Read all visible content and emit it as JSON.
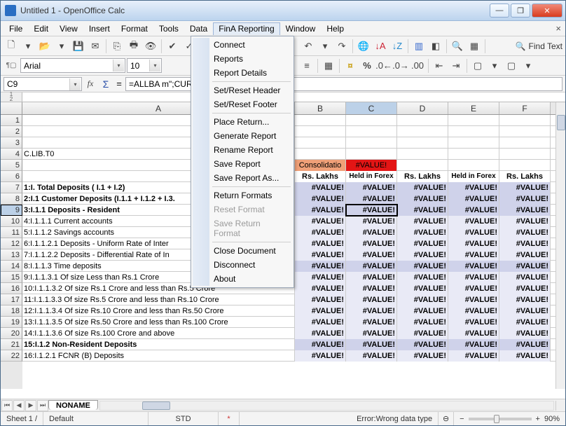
{
  "title": "Untitled 1 - OpenOffice Calc",
  "menus": [
    "File",
    "Edit",
    "View",
    "Insert",
    "Format",
    "Tools",
    "Data",
    "FinA Reporting",
    "Window",
    "Help"
  ],
  "open_menu_index": 7,
  "dropdown": {
    "groups": [
      [
        "Connect",
        "Reports",
        "Report Details"
      ],
      [
        "Set/Reset Header",
        "Set/Reset Footer"
      ],
      [
        "Place Return...",
        "Generate Report",
        "Rename Report",
        "Save Report",
        "Save Report As..."
      ],
      [
        "Return Formats",
        "Reset Format",
        "Save Return Format"
      ],
      [
        "Close Document",
        "Disconnect",
        "About"
      ]
    ],
    "disabled": [
      "Reset Format",
      "Save Return Format"
    ]
  },
  "find_label": "Find Text",
  "font": {
    "name": "Arial",
    "size": "10"
  },
  "namebox": "C9",
  "formula": "=ALLBA                                   m\";CURPERIOD();\"last\";0)",
  "columns": [
    "A",
    "B",
    "C",
    "D",
    "E",
    "F"
  ],
  "selected_col": "C",
  "col_widths": {
    "A": 389,
    "B": 73,
    "C": 73,
    "D": 73,
    "E": 73,
    "F": 73
  },
  "row_start": 1,
  "row_end": 22,
  "selected_row": 9,
  "a_values": {
    "4": "C.LIB.T0",
    "7": "1:I. Total Deposits ( I.1 + I.2)",
    "8": "2:I.1 Customer Deposits (I.1.1 + I.1.2 + I.3.",
    "9": "3:I.1.1 Deposits - Resident",
    "10": "4:I.1.1.1 Current accounts",
    "11": "5:I.1.1.2 Savings accounts",
    "12": "6:I.1.1.2.1 Deposits - Uniform Rate of Inter",
    "13": "7:I.1.1.2.2 Deposits - Differential Rate of In",
    "14": "8:I.1.1.3 Time deposits",
    "15": "9:I.1.1.3.1 Of size Less than Rs.1 Crore",
    "16": "10:I.1.1.3.2 Of size Rs.1 Crore and less than Rs.5 Crore",
    "17": "11:I.1.1.3.3 Of size Rs.5 Crore and less than Rs.10 Crore",
    "18": "12:I.1.1.3.4 Of size Rs.10 Crore and less than Rs.50 Crore",
    "19": "13:I.1.1.3.5 Of size Rs.50 Crore and less than Rs.100 Crore",
    "20": "14:I.1.1.3.6 Of size Rs.100 Crore and above",
    "21": "15:I.1.2 Non-Resident Deposits",
    "22": "16:I.1.2.1 FCNR (B) Deposits"
  },
  "header_row5": {
    "B": "Consolidatio",
    "C": "#VALUE!"
  },
  "header_row6": {
    "B": "Rs. Lakhs",
    "C": "Held in Forex",
    "D": "Rs. Lakhs",
    "E": "Held in Forex",
    "F": "Rs. Lakhs"
  },
  "value_cell": "#VALUE!",
  "sheet_tab": "NONAME",
  "status": {
    "sheet": "Sheet 1 /",
    "style": "Default",
    "mode": "STD",
    "modified": "*",
    "error": "Error:Wrong data type",
    "extra": "⊖",
    "zoom": "90%"
  }
}
